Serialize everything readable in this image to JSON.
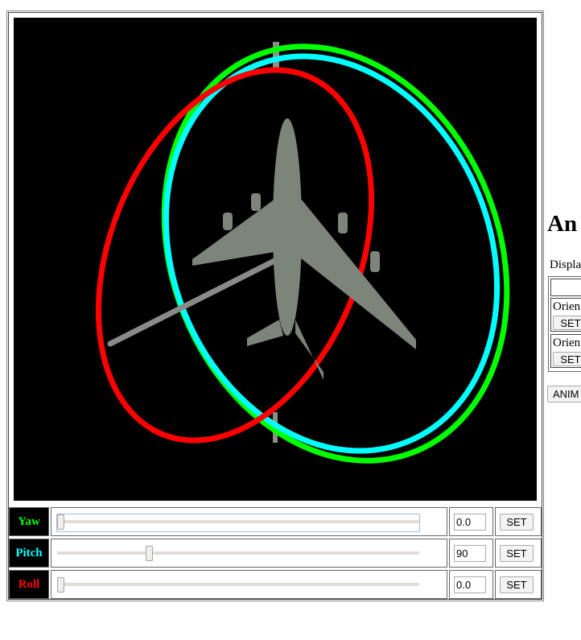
{
  "viewer": {
    "ring_colors": {
      "yaw": "#00ff00",
      "pitch": "#00ffff",
      "roll": "#ff0000"
    },
    "background": "#000000"
  },
  "controls": [
    {
      "label": "Yaw",
      "color": "#00ff00",
      "value": "0.0",
      "slider_fraction": 0.0,
      "set_label": "SET"
    },
    {
      "label": "Pitch",
      "color": "#00ffff",
      "value": "90",
      "slider_fraction": 0.25,
      "set_label": "SET"
    },
    {
      "label": "Roll",
      "color": "#ff0000",
      "value": "0.0",
      "slider_fraction": 0.0,
      "set_label": "SET"
    }
  ],
  "side": {
    "heading": "An",
    "display_label": "Displa",
    "orient1": "Orien",
    "orient2": "Orien",
    "set1": "SET",
    "set2": "SET",
    "animate": "ANIM"
  }
}
